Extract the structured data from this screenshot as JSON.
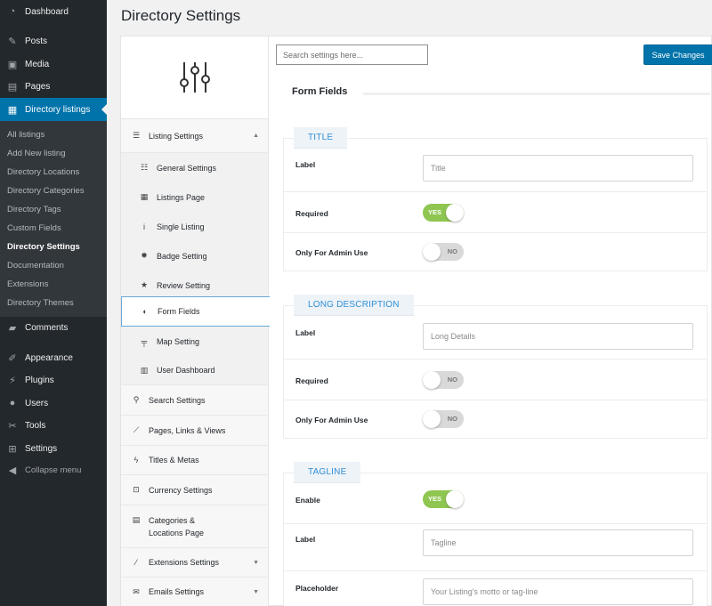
{
  "admin_menu": {
    "items": [
      {
        "label": "Dashboard",
        "icon": "dashboard-icon"
      },
      {
        "label": "Posts",
        "icon": "pin-icon"
      },
      {
        "label": "Media",
        "icon": "media-icon"
      },
      {
        "label": "Pages",
        "icon": "page-icon"
      },
      {
        "label": "Directory listings",
        "icon": "listing-icon"
      },
      {
        "label": "Comments",
        "icon": "comment-icon"
      },
      {
        "label": "Appearance",
        "icon": "brush-icon"
      },
      {
        "label": "Plugins",
        "icon": "plugin-icon"
      },
      {
        "label": "Users",
        "icon": "user-icon"
      },
      {
        "label": "Tools",
        "icon": "wrench-icon"
      },
      {
        "label": "Settings",
        "icon": "settings-icon"
      }
    ],
    "submenu": [
      "All listings",
      "Add New listing",
      "Directory Locations",
      "Directory Categories",
      "Directory Tags",
      "Custom Fields",
      "Directory Settings",
      "Documentation",
      "Extensions",
      "Directory Themes"
    ],
    "collapse_label": "Collapse menu"
  },
  "page": {
    "title": "Directory Settings"
  },
  "settings_nav": {
    "listing_settings": "Listing Settings",
    "sub_items": [
      "General Settings",
      "Listings Page",
      "Single Listing",
      "Badge Setting",
      "Review Setting",
      "Form Fields",
      "Map Setting",
      "User Dashboard"
    ],
    "top_items": [
      "Search Settings",
      "Pages, Links & Views",
      "Titles & Metas",
      "Currency Settings",
      "Categories &",
      "Locations Page",
      "Extensions Settings",
      "Emails Settings"
    ]
  },
  "toolbar": {
    "search_placeholder": "Search settings here...",
    "save_label": "Save Changes"
  },
  "content": {
    "heading": "Form Fields",
    "title_section": {
      "tab": "TITLE",
      "label_label": "Label",
      "label_value": "Title",
      "required_label": "Required",
      "required_state": "YES",
      "admin_label": "Only For Admin Use",
      "admin_state": "NO"
    },
    "description_section": {
      "tab": "LONG DESCRIPTION",
      "label_label": "Label",
      "label_value": "Long Details",
      "required_label": "Required",
      "required_state": "NO",
      "admin_label": "Only For Admin Use",
      "admin_state": "NO"
    },
    "tagline_section": {
      "tab": "TAGLINE",
      "enable_label": "Enable",
      "enable_state": "YES",
      "label_label": "Label",
      "label_value": "Tagline",
      "placeholder_label": "Placeholder",
      "placeholder_value": "Your Listing's motto or tag-line"
    }
  },
  "colors": {
    "accent": "#0073aa",
    "sidebar": "#23282d",
    "toggle_on": "#8fc651",
    "tab_text": "#2f8fd6"
  }
}
